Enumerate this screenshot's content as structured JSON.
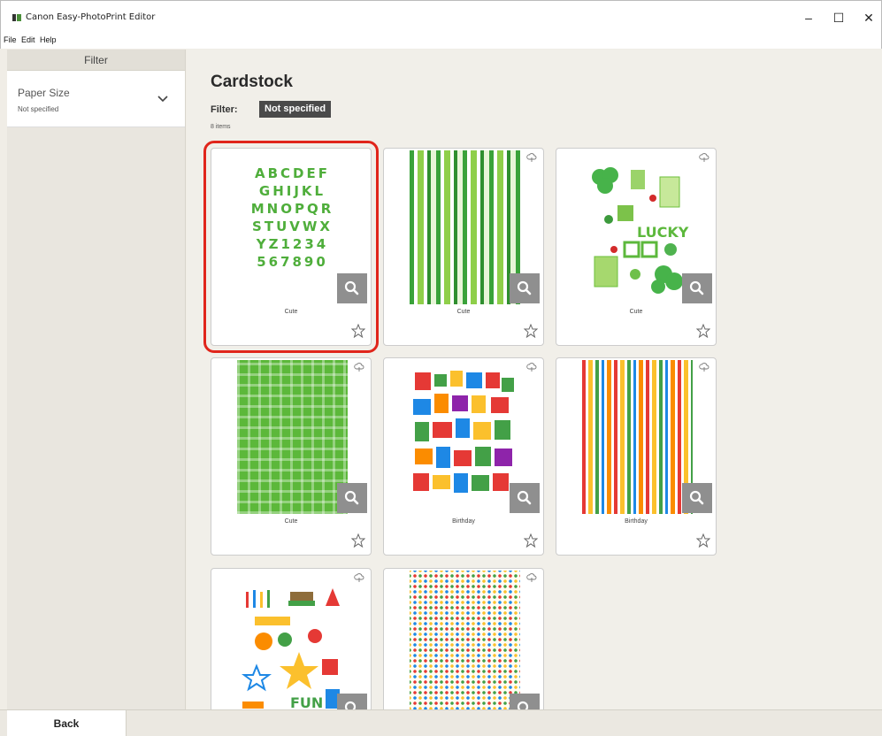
{
  "window": {
    "title": "Canon Easy-PhotoPrint Editor",
    "min_glyph": "–",
    "max_glyph": "☐",
    "close_glyph": "✕"
  },
  "menu": {
    "file": "File",
    "edit": "Edit",
    "help": "Help"
  },
  "sidebar": {
    "header": "Filter",
    "paper_size_label": "Paper Size",
    "paper_size_value": "Not specified"
  },
  "main": {
    "title": "Cardstock",
    "filter_label": "Filter:",
    "filter_value": "Not specified",
    "count": "8 items"
  },
  "cards": [
    {
      "label": "Cute",
      "selected": true
    },
    {
      "label": "Cute"
    },
    {
      "label": "Cute"
    },
    {
      "label": "Cute"
    },
    {
      "label": "Birthday"
    },
    {
      "label": "Birthday"
    },
    {
      "label": ""
    },
    {
      "label": ""
    }
  ],
  "alphabet_rows": [
    "ABCDEF",
    "GHIJKL",
    "MNOPQR",
    "STUVWX",
    "YZ1234",
    "567890"
  ],
  "bottom": {
    "back": "Back"
  },
  "colors": {
    "selection": "#e0251b",
    "badge": "#4a4a4a",
    "zoom": "#8f8f8f"
  }
}
